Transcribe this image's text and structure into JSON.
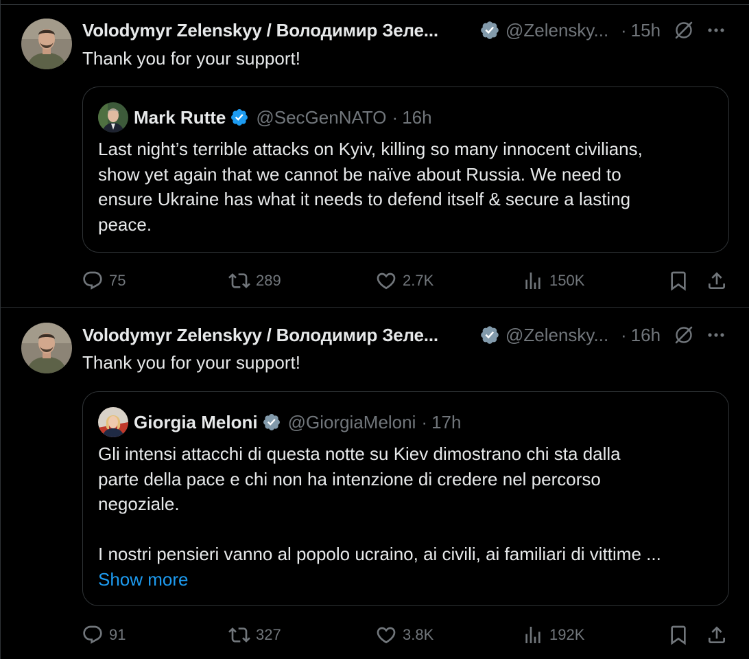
{
  "tweets": [
    {
      "author": "Volodymyr Zelenskyy / Володимир Зеле...",
      "handle": "@Zelensky...",
      "separator": "·",
      "time": "15h",
      "text": "Thank you for your support!",
      "quote": {
        "author": "Mark Rutte",
        "handle": "@SecGenNATO",
        "separator": "·",
        "time": "16h",
        "lines": [
          "Last night’s terrible attacks on Kyiv, killing so many innocent civilians,",
          "show yet again that we cannot be naïve about Russia. We need to",
          "ensure Ukraine has what it needs to defend itself & secure a lasting",
          "peace."
        ]
      },
      "stats": {
        "replies": "75",
        "reposts": "289",
        "likes": "2.7K",
        "views": "150K"
      }
    },
    {
      "author": "Volodymyr Zelenskyy / Володимир Зеле...",
      "handle": "@Zelensky...",
      "separator": "·",
      "time": "16h",
      "text": "Thank you for your support!",
      "quote": {
        "author": "Giorgia Meloni",
        "handle": "@GiorgiaMeloni",
        "separator": "·",
        "time": "17h",
        "lines": [
          "Gli intensi attacchi di questa notte su Kiev dimostrano chi sta dalla",
          "parte della pace e chi non ha intenzione di credere nel percorso",
          "negoziale.",
          "",
          "I nostri pensieri vanno al popolo ucraino, ai civili, ai familiari di vittime ..."
        ],
        "show_more": "Show more"
      },
      "stats": {
        "replies": "91",
        "reposts": "327",
        "likes": "3.8K",
        "views": "192K"
      }
    }
  ],
  "icons": {
    "verified_color": "#1d9bf0",
    "verified_gray_color": "#829aab",
    "muted_color": "#71767b",
    "names": [
      "verified-badge-icon",
      "grok-icon",
      "more-icon",
      "reply-icon",
      "repost-icon",
      "like-icon",
      "views-icon",
      "bookmark-icon",
      "share-icon"
    ]
  }
}
